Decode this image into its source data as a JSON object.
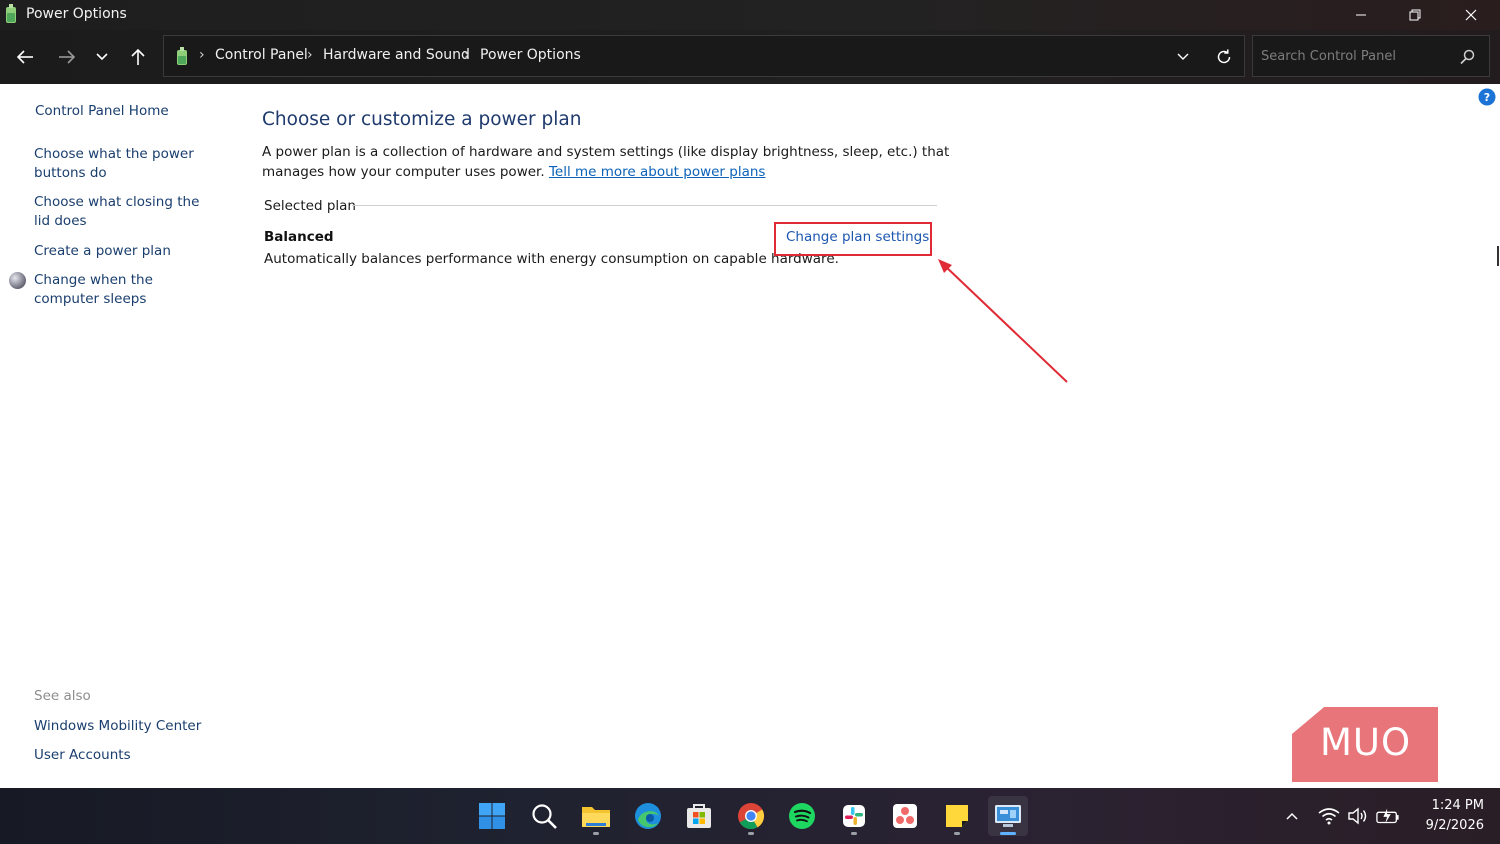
{
  "window": {
    "title": "Power Options"
  },
  "address_bar": {
    "breadcrumbs": [
      "Control Panel",
      "Hardware and Sound",
      "Power Options"
    ],
    "search_placeholder": "Search Control Panel"
  },
  "sidebar": {
    "home": "Control Panel Home",
    "links": [
      "Choose what the power buttons do",
      "Choose what closing the lid does",
      "Create a power plan",
      "Change when the computer sleeps"
    ],
    "see_also_label": "See also",
    "see_also": [
      "Windows Mobility Center",
      "User Accounts"
    ]
  },
  "main": {
    "title": "Choose or customize a power plan",
    "description": "A power plan is a collection of hardware and system settings (like display brightness, sleep, etc.) that manages how your computer uses power.",
    "learn_more_link": "Tell me more about power plans",
    "selected_plan_label": "Selected plan",
    "plan": {
      "name": "Balanced",
      "description": "Automatically balances performance with energy consumption on capable hardware.",
      "change_link": "Change plan settings"
    }
  },
  "watermark": {
    "text": "MUO"
  },
  "taskbar": {
    "apps": [
      "start-icon",
      "search-icon",
      "file-explorer-icon",
      "edge-icon",
      "microsoft-store-icon",
      "chrome-icon",
      "spotify-icon",
      "slack-icon",
      "asana-icon",
      "sticky-notes-icon",
      "control-panel-icon"
    ],
    "time": "1:24 PM",
    "date": "9/2/2026"
  },
  "colors": {
    "annotation_red": "#e02b36",
    "link_blue": "#0b62b8",
    "title_blue": "#1f3a6d"
  }
}
